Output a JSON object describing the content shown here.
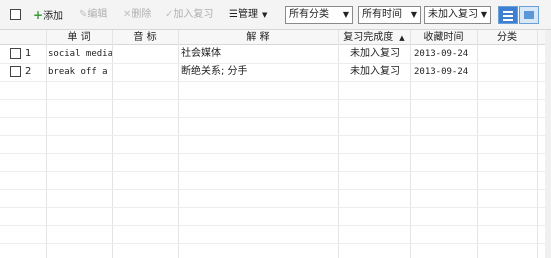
{
  "toolbar": {
    "add": "添加",
    "edit": "编辑",
    "delete": "删除",
    "add_review": "加入复习",
    "manage": "管理",
    "filter_category": "所有分类",
    "filter_time": "所有时间",
    "filter_review": "未加入复习"
  },
  "columns": {
    "word": "单 词",
    "phonetic": "音 标",
    "meaning": "解 释",
    "review_progress": "复习完成度",
    "saved_time": "收藏时间",
    "category": "分类"
  },
  "rows": [
    {
      "index": "1",
      "word": "social media",
      "phonetic": "",
      "meaning": "社会媒体",
      "review": "未加入复习",
      "date": "2013-09-24",
      "category": ""
    },
    {
      "index": "2",
      "word": "break off a",
      "phonetic": "",
      "meaning": "断绝关系; 分手",
      "review": "未加入复习",
      "date": "2013-09-24",
      "category": ""
    }
  ]
}
